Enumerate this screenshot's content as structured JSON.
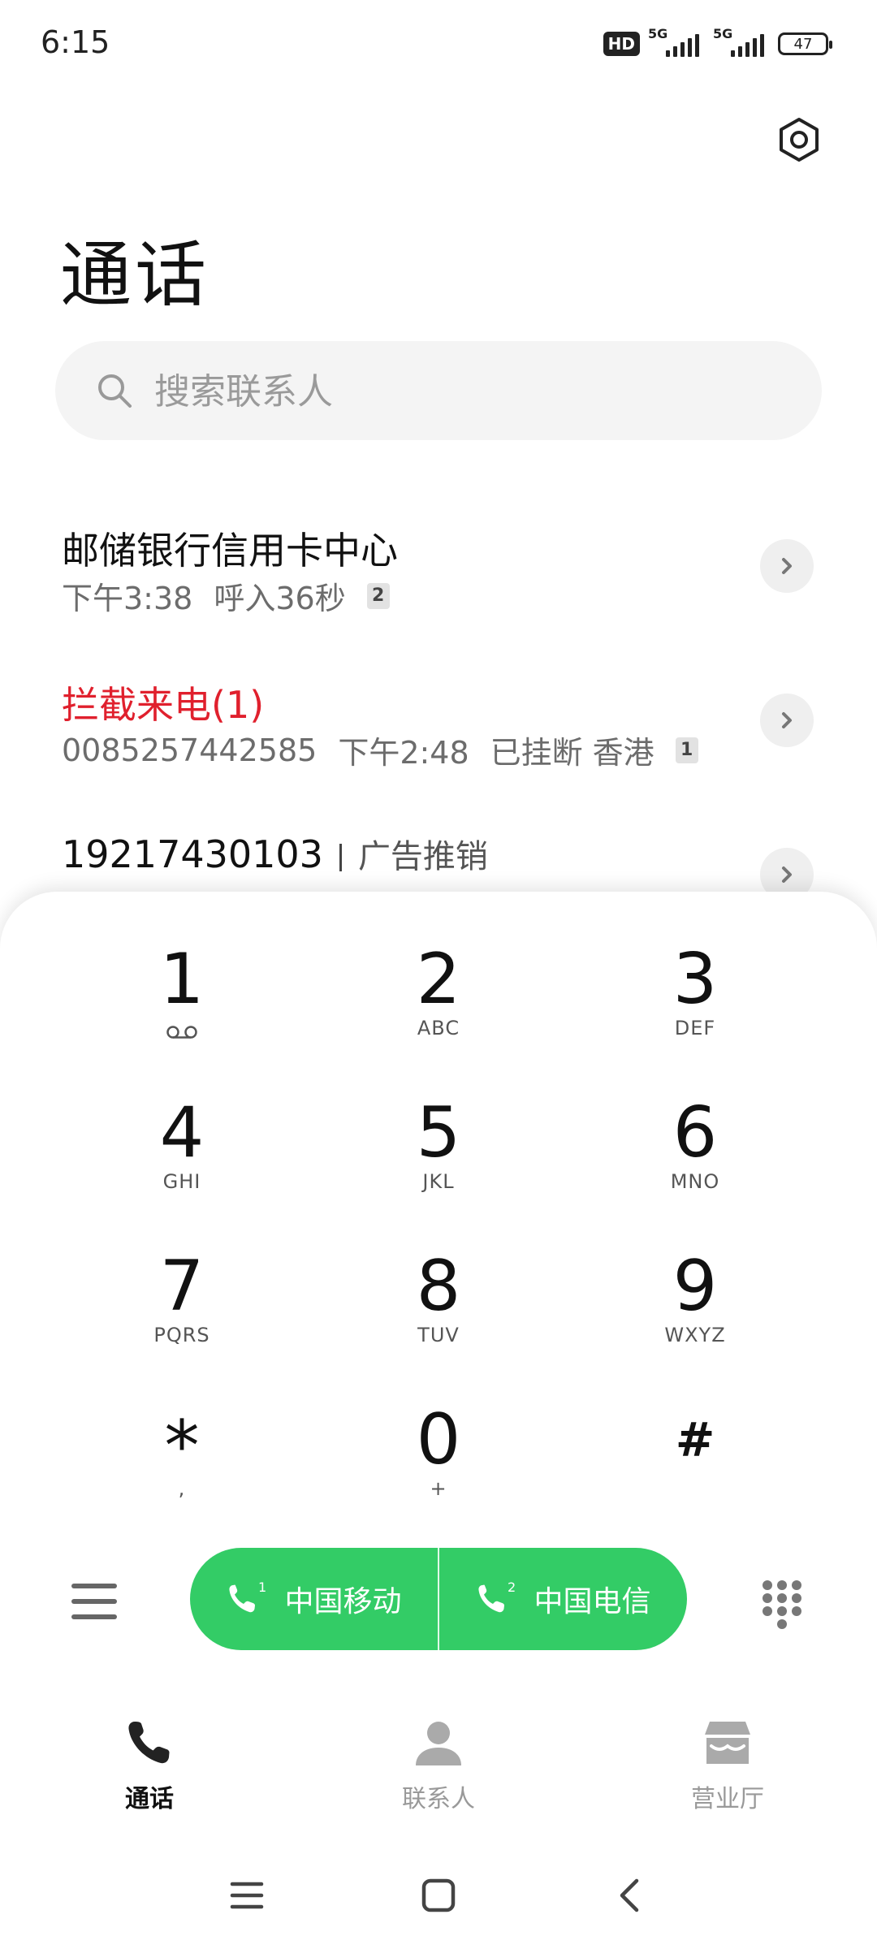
{
  "status_bar": {
    "time": "6:15",
    "hd_badge": "HD",
    "sim1_network": "5G",
    "sim2_network": "5G",
    "battery": "47"
  },
  "header": {
    "title": "通话",
    "settings_icon": "gear-icon"
  },
  "search": {
    "placeholder": "搜索联系人"
  },
  "call_log": [
    {
      "name": "邮储银行信用卡中心",
      "time": "下午3:38",
      "detail": "呼入36秒",
      "sim": "2"
    },
    {
      "name": "拦截来电(1)",
      "number": "0085257442585",
      "time": "下午2:48",
      "detail": "已挂断",
      "location": "香港",
      "sim": "1"
    },
    {
      "name": "19217430103",
      "tag": "广告推销"
    }
  ],
  "keypad": [
    {
      "digit": "1",
      "letters": ""
    },
    {
      "digit": "2",
      "letters": "ABC"
    },
    {
      "digit": "3",
      "letters": "DEF"
    },
    {
      "digit": "4",
      "letters": "GHI"
    },
    {
      "digit": "5",
      "letters": "JKL"
    },
    {
      "digit": "6",
      "letters": "MNO"
    },
    {
      "digit": "7",
      "letters": "PQRS"
    },
    {
      "digit": "8",
      "letters": "TUV"
    },
    {
      "digit": "9",
      "letters": "WXYZ"
    },
    {
      "digit": "*",
      "letters": ","
    },
    {
      "digit": "0",
      "letters": "+"
    },
    {
      "digit": "#",
      "letters": ""
    }
  ],
  "call_buttons": [
    {
      "sim": "1",
      "carrier": "中国移动"
    },
    {
      "sim": "2",
      "carrier": "中国电信"
    }
  ],
  "tabs": [
    {
      "label": "通话",
      "icon": "phone-icon",
      "active": true
    },
    {
      "label": "联系人",
      "icon": "person-icon",
      "active": false
    },
    {
      "label": "营业厅",
      "icon": "store-icon",
      "active": false
    }
  ],
  "colors": {
    "call_green": "#33cc66",
    "blocked_red": "#e0202d"
  }
}
